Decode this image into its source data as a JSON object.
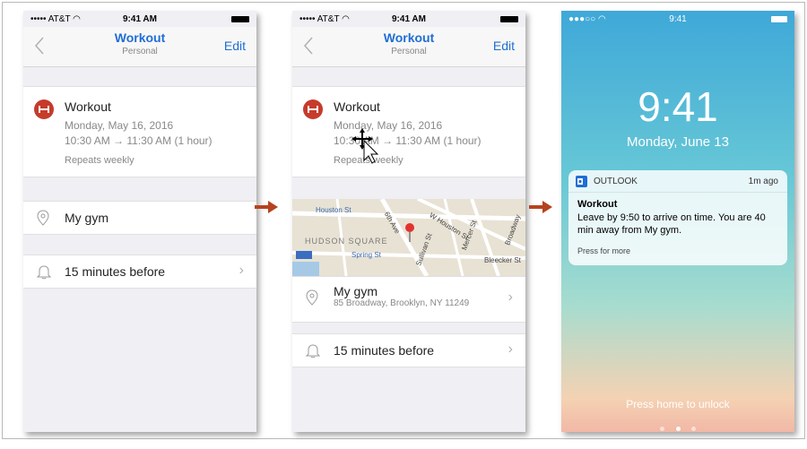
{
  "status": {
    "carrier": "••••• AT&T ◠",
    "time": "9:41 AM"
  },
  "nav": {
    "title": "Workout",
    "subtitle": "Personal",
    "edit": "Edit"
  },
  "event": {
    "title": "Workout",
    "date": "Monday, May 16, 2016",
    "time": "10:30 AM → 11:30 AM (1 hour)",
    "repeat": "Repeats weekly"
  },
  "location": {
    "label": "My gym",
    "address": "85 Broadway, Brooklyn, NY 11249"
  },
  "reminder": {
    "label": "15 minutes before"
  },
  "map": {
    "streets": [
      "Houston St",
      "W Houston St",
      "Spring St",
      "Bleecker St",
      "Sullivan St",
      "6th Ave",
      "Mercer St",
      "Broadway"
    ],
    "neighborhood": "HUDSON SQUARE"
  },
  "lock": {
    "carrier": "●●●○○ ◠",
    "time_small": "9:41",
    "time": "9:41",
    "date": "Monday, June 13",
    "unlock": "Press home to unlock"
  },
  "notification": {
    "app": "OUTLOOK",
    "age": "1m ago",
    "title": "Workout",
    "body": "Leave by 9:50 to arrive on time. You are 40 min away from My gym.",
    "more": "Press for more"
  },
  "colors": {
    "accent": "#1f6ed4",
    "event_red": "#c63b2b",
    "arrow": "#b5431f"
  }
}
